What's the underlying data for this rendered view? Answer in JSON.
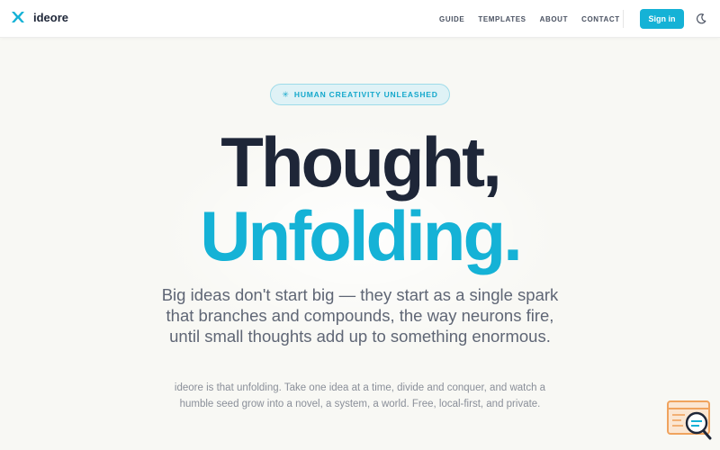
{
  "brand": {
    "name": "ideore",
    "logo_icon": "ideore-logo-icon",
    "accent": "#15b2d6",
    "dark": "#1e2638"
  },
  "nav": {
    "items": [
      {
        "label": "GUIDE"
      },
      {
        "label": "TEMPLATES"
      },
      {
        "label": "ABOUT"
      },
      {
        "label": "CONTACT"
      }
    ],
    "signin_label": "Sign in",
    "theme_icon": "moon-icon"
  },
  "hero": {
    "badge_icon": "sparkle-icon",
    "badge_text": "HUMAN CREATIVITY UNLEASHED",
    "headline_line1": "Thought,",
    "headline_line2": "Unfolding.",
    "lead": "Big ideas don't start big — they start as a single spark that branches and compounds, the way neurons fire, until small thoughts add up to something enormous.",
    "sub": "ideore is that unfolding. Take one idea at a time, divide and conquer, and watch a humble seed grow into a novel, a system, a world. Free, local-first, and private."
  },
  "widget": {
    "icon": "help-search-icon"
  }
}
